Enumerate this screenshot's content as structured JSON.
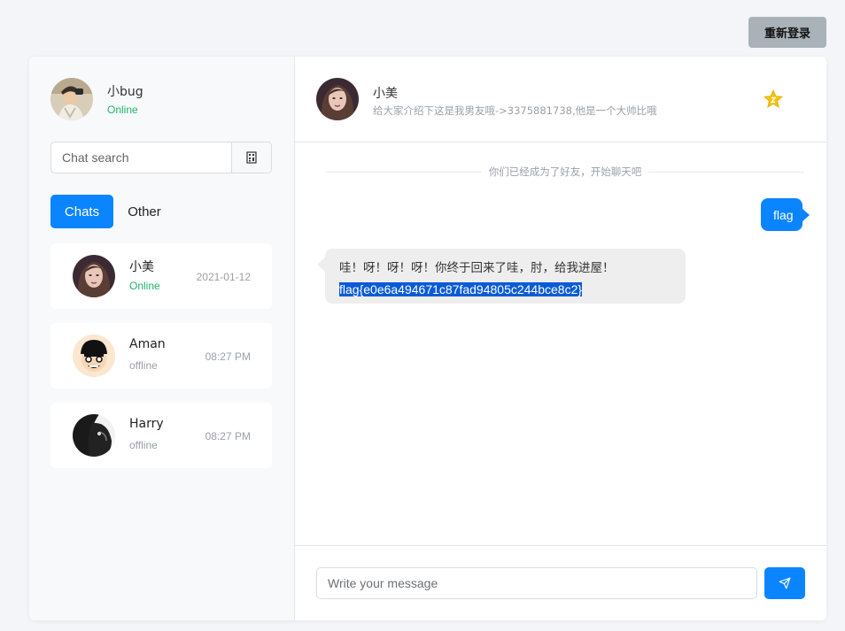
{
  "top_bar": {
    "relogin_label": "重新登录"
  },
  "sidebar": {
    "profile": {
      "name": "小bug",
      "status": "Online"
    },
    "search": {
      "placeholder": "Chat search"
    },
    "tabs": [
      {
        "label": "Chats",
        "active": true
      },
      {
        "label": "Other",
        "active": false
      }
    ],
    "chats": [
      {
        "name": "小美",
        "status": "Online",
        "time": "2021-01-12"
      },
      {
        "name": "Aman",
        "status": "offline",
        "time": "08:27 PM"
      },
      {
        "name": "Harry",
        "status": "offline",
        "time": "08:27 PM"
      }
    ]
  },
  "conversation": {
    "header": {
      "name": "小美",
      "description": "给大家介绍下这是我男友哦->3375881738,他是一个大帅比哦"
    },
    "divider_text": "你们已经成为了好友，开始聊天吧",
    "messages": [
      {
        "direction": "out",
        "text": "flag"
      },
      {
        "direction": "in",
        "text": "哇！呀！呀！呀！你终于回来了哇，肘，给我进屋！",
        "highlight": "flag{e0e6a494671c87fad94805c244bce8c2}"
      }
    ],
    "composer": {
      "placeholder": "Write your message"
    }
  },
  "colors": {
    "accent": "#0a84ff",
    "online": "#1cb66a",
    "muted": "#9aa0a8",
    "star": "#f5c400"
  },
  "icons": [
    "search-icon",
    "star-icon",
    "send-icon"
  ]
}
